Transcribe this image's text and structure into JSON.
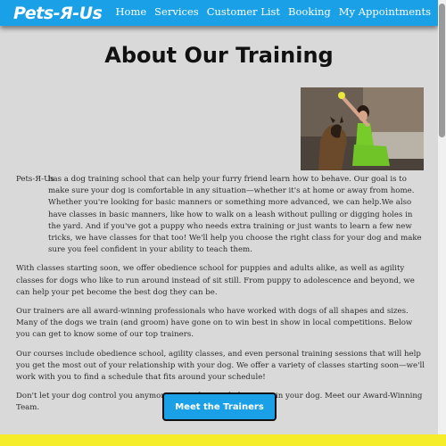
{
  "nav": {
    "logo": "Pets-Я-Us",
    "links": [
      "Home",
      "Services",
      "Customer List",
      "Booking",
      "My Appointments"
    ]
  },
  "page": {
    "title": "About Our Training"
  },
  "content": {
    "p1_brand": "Pets-Я-Us",
    "p1_text": "has a dog training school that can help your furry friend learn how to behave. Our goal is to make sure your dog is comfortable in any situation—whether it's at home or away from home. Whether you're looking for basic manners or something more advanced, we can help.We also have classes in basic manners, like how to walk on a leash without pulling or digging holes in the yard. And if you've got a puppy who needs extra training or just wants to learn a few new tricks, we have classes for that too! We'll help you choose the right class for your dog and make sure you feel confident in your ability to teach them.",
    "p2": "With classes starting soon, we offer obedience school for puppies and adults alike, as well as agility classes for dogs who like to run around instead of sit still. From puppy to adolescence and beyond, we can help your pet become the best dog they can be.",
    "p3": "Our trainers are all award-winning professionals who have worked with dogs of all shapes and sizes. Many of the dogs we train (and groom) have gone on to win best in show in local competitions. Below you can get to know some of our top trainers.",
    "p4": "Our courses include obedience school, agility classes, and even personal training sessions that will help you get the most out of your relationship with your dog. We offer a variety of classes starting soon—we'll work with you to find a schedule that fits around your schedule!",
    "p5": "Don't let your dog control you anymore. We're here to help you train your dog. Meet our Award-Winning Team."
  },
  "cta": {
    "label": "Meet the Trainers"
  },
  "colors": {
    "accent": "#1aa0e6",
    "background": "#d9d9d9",
    "footer": "#f5ec2a"
  }
}
